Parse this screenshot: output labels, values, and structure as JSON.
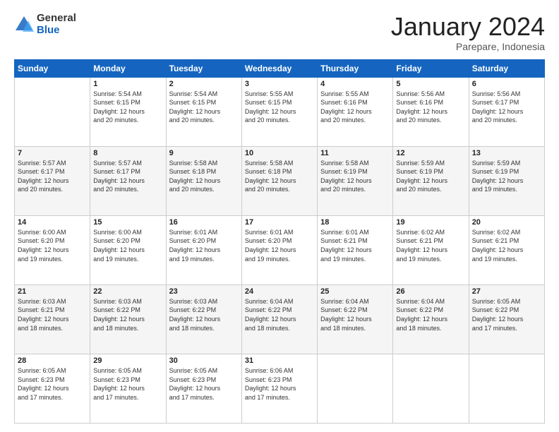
{
  "logo": {
    "general": "General",
    "blue": "Blue"
  },
  "header": {
    "month": "January 2024",
    "location": "Parepare, Indonesia"
  },
  "weekdays": [
    "Sunday",
    "Monday",
    "Tuesday",
    "Wednesday",
    "Thursday",
    "Friday",
    "Saturday"
  ],
  "weeks": [
    [
      {
        "day": "",
        "sunrise": "",
        "sunset": "",
        "daylight": ""
      },
      {
        "day": "1",
        "sunrise": "Sunrise: 5:54 AM",
        "sunset": "Sunset: 6:15 PM",
        "daylight": "Daylight: 12 hours and 20 minutes."
      },
      {
        "day": "2",
        "sunrise": "Sunrise: 5:54 AM",
        "sunset": "Sunset: 6:15 PM",
        "daylight": "Daylight: 12 hours and 20 minutes."
      },
      {
        "day": "3",
        "sunrise": "Sunrise: 5:55 AM",
        "sunset": "Sunset: 6:15 PM",
        "daylight": "Daylight: 12 hours and 20 minutes."
      },
      {
        "day": "4",
        "sunrise": "Sunrise: 5:55 AM",
        "sunset": "Sunset: 6:16 PM",
        "daylight": "Daylight: 12 hours and 20 minutes."
      },
      {
        "day": "5",
        "sunrise": "Sunrise: 5:56 AM",
        "sunset": "Sunset: 6:16 PM",
        "daylight": "Daylight: 12 hours and 20 minutes."
      },
      {
        "day": "6",
        "sunrise": "Sunrise: 5:56 AM",
        "sunset": "Sunset: 6:17 PM",
        "daylight": "Daylight: 12 hours and 20 minutes."
      }
    ],
    [
      {
        "day": "7",
        "sunrise": "Sunrise: 5:57 AM",
        "sunset": "Sunset: 6:17 PM",
        "daylight": "Daylight: 12 hours and 20 minutes."
      },
      {
        "day": "8",
        "sunrise": "Sunrise: 5:57 AM",
        "sunset": "Sunset: 6:17 PM",
        "daylight": "Daylight: 12 hours and 20 minutes."
      },
      {
        "day": "9",
        "sunrise": "Sunrise: 5:58 AM",
        "sunset": "Sunset: 6:18 PM",
        "daylight": "Daylight: 12 hours and 20 minutes."
      },
      {
        "day": "10",
        "sunrise": "Sunrise: 5:58 AM",
        "sunset": "Sunset: 6:18 PM",
        "daylight": "Daylight: 12 hours and 20 minutes."
      },
      {
        "day": "11",
        "sunrise": "Sunrise: 5:58 AM",
        "sunset": "Sunset: 6:19 PM",
        "daylight": "Daylight: 12 hours and 20 minutes."
      },
      {
        "day": "12",
        "sunrise": "Sunrise: 5:59 AM",
        "sunset": "Sunset: 6:19 PM",
        "daylight": "Daylight: 12 hours and 20 minutes."
      },
      {
        "day": "13",
        "sunrise": "Sunrise: 5:59 AM",
        "sunset": "Sunset: 6:19 PM",
        "daylight": "Daylight: 12 hours and 19 minutes."
      }
    ],
    [
      {
        "day": "14",
        "sunrise": "Sunrise: 6:00 AM",
        "sunset": "Sunset: 6:20 PM",
        "daylight": "Daylight: 12 hours and 19 minutes."
      },
      {
        "day": "15",
        "sunrise": "Sunrise: 6:00 AM",
        "sunset": "Sunset: 6:20 PM",
        "daylight": "Daylight: 12 hours and 19 minutes."
      },
      {
        "day": "16",
        "sunrise": "Sunrise: 6:01 AM",
        "sunset": "Sunset: 6:20 PM",
        "daylight": "Daylight: 12 hours and 19 minutes."
      },
      {
        "day": "17",
        "sunrise": "Sunrise: 6:01 AM",
        "sunset": "Sunset: 6:20 PM",
        "daylight": "Daylight: 12 hours and 19 minutes."
      },
      {
        "day": "18",
        "sunrise": "Sunrise: 6:01 AM",
        "sunset": "Sunset: 6:21 PM",
        "daylight": "Daylight: 12 hours and 19 minutes."
      },
      {
        "day": "19",
        "sunrise": "Sunrise: 6:02 AM",
        "sunset": "Sunset: 6:21 PM",
        "daylight": "Daylight: 12 hours and 19 minutes."
      },
      {
        "day": "20",
        "sunrise": "Sunrise: 6:02 AM",
        "sunset": "Sunset: 6:21 PM",
        "daylight": "Daylight: 12 hours and 19 minutes."
      }
    ],
    [
      {
        "day": "21",
        "sunrise": "Sunrise: 6:03 AM",
        "sunset": "Sunset: 6:21 PM",
        "daylight": "Daylight: 12 hours and 18 minutes."
      },
      {
        "day": "22",
        "sunrise": "Sunrise: 6:03 AM",
        "sunset": "Sunset: 6:22 PM",
        "daylight": "Daylight: 12 hours and 18 minutes."
      },
      {
        "day": "23",
        "sunrise": "Sunrise: 6:03 AM",
        "sunset": "Sunset: 6:22 PM",
        "daylight": "Daylight: 12 hours and 18 minutes."
      },
      {
        "day": "24",
        "sunrise": "Sunrise: 6:04 AM",
        "sunset": "Sunset: 6:22 PM",
        "daylight": "Daylight: 12 hours and 18 minutes."
      },
      {
        "day": "25",
        "sunrise": "Sunrise: 6:04 AM",
        "sunset": "Sunset: 6:22 PM",
        "daylight": "Daylight: 12 hours and 18 minutes."
      },
      {
        "day": "26",
        "sunrise": "Sunrise: 6:04 AM",
        "sunset": "Sunset: 6:22 PM",
        "daylight": "Daylight: 12 hours and 18 minutes."
      },
      {
        "day": "27",
        "sunrise": "Sunrise: 6:05 AM",
        "sunset": "Sunset: 6:22 PM",
        "daylight": "Daylight: 12 hours and 17 minutes."
      }
    ],
    [
      {
        "day": "28",
        "sunrise": "Sunrise: 6:05 AM",
        "sunset": "Sunset: 6:23 PM",
        "daylight": "Daylight: 12 hours and 17 minutes."
      },
      {
        "day": "29",
        "sunrise": "Sunrise: 6:05 AM",
        "sunset": "Sunset: 6:23 PM",
        "daylight": "Daylight: 12 hours and 17 minutes."
      },
      {
        "day": "30",
        "sunrise": "Sunrise: 6:05 AM",
        "sunset": "Sunset: 6:23 PM",
        "daylight": "Daylight: 12 hours and 17 minutes."
      },
      {
        "day": "31",
        "sunrise": "Sunrise: 6:06 AM",
        "sunset": "Sunset: 6:23 PM",
        "daylight": "Daylight: 12 hours and 17 minutes."
      },
      {
        "day": "",
        "sunrise": "",
        "sunset": "",
        "daylight": ""
      },
      {
        "day": "",
        "sunrise": "",
        "sunset": "",
        "daylight": ""
      },
      {
        "day": "",
        "sunrise": "",
        "sunset": "",
        "daylight": ""
      }
    ]
  ]
}
